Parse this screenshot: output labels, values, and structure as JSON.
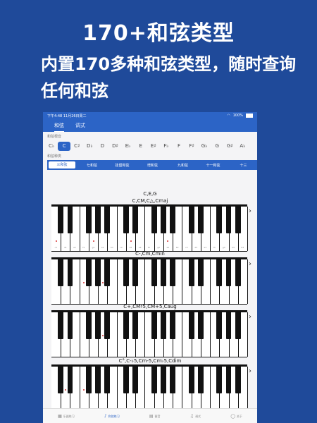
{
  "promo": {
    "title": "170+和弦类型",
    "subtitle": "内置170多种和弦类型，随时查询任何和弦"
  },
  "status": {
    "time": "下午4:48",
    "date": "11月26日周二",
    "battery": "100%"
  },
  "nav_tabs": [
    {
      "label": "和弦",
      "active": true
    },
    {
      "label": "调式",
      "active": false
    }
  ],
  "root_label": "和弦根音",
  "roots": [
    "C♭",
    "C",
    "C♯",
    "D♭",
    "D",
    "D♯",
    "E♭",
    "E",
    "E♯",
    "F♭",
    "F",
    "F♯",
    "G♭",
    "G",
    "G♯",
    "A♭"
  ],
  "selected_root": 1,
  "type_label": "和弦种类",
  "types": [
    "三和弦",
    "七和弦",
    "挂留和弦",
    "增和弦",
    "九和弦",
    "十一和弦",
    "十三"
  ],
  "selected_type": 0,
  "chords": [
    {
      "notes": "C,E,G",
      "names": "C,CM,C△,Cmaj"
    },
    {
      "notes": "",
      "names": "C-,Cm,Cmin"
    },
    {
      "notes": "",
      "names": "C+,CM♯5,CM+5,Caug"
    },
    {
      "notes": "",
      "names": "C°,C-♭5,Cm-5,Cm♭5,Cdim"
    }
  ],
  "key_labels": [
    "c1",
    "d1",
    "e1",
    "f1",
    "g1",
    "a1",
    "b1",
    "c2",
    "d2",
    "e2",
    "f2",
    "g2",
    "a2",
    "b2",
    "c3",
    "d3",
    "e3",
    "f3",
    "g3",
    "a3",
    "b3"
  ],
  "tabbar": [
    {
      "label": "乐器练习",
      "icon": "grid-icon",
      "active": false
    },
    {
      "label": "和弦练习",
      "icon": "music-note-icon",
      "active": true
    },
    {
      "label": "琶音",
      "icon": "list-icon",
      "active": false
    },
    {
      "label": "调式",
      "icon": "notes-icon",
      "active": false
    },
    {
      "label": "关于",
      "icon": "person-icon",
      "active": false
    }
  ]
}
